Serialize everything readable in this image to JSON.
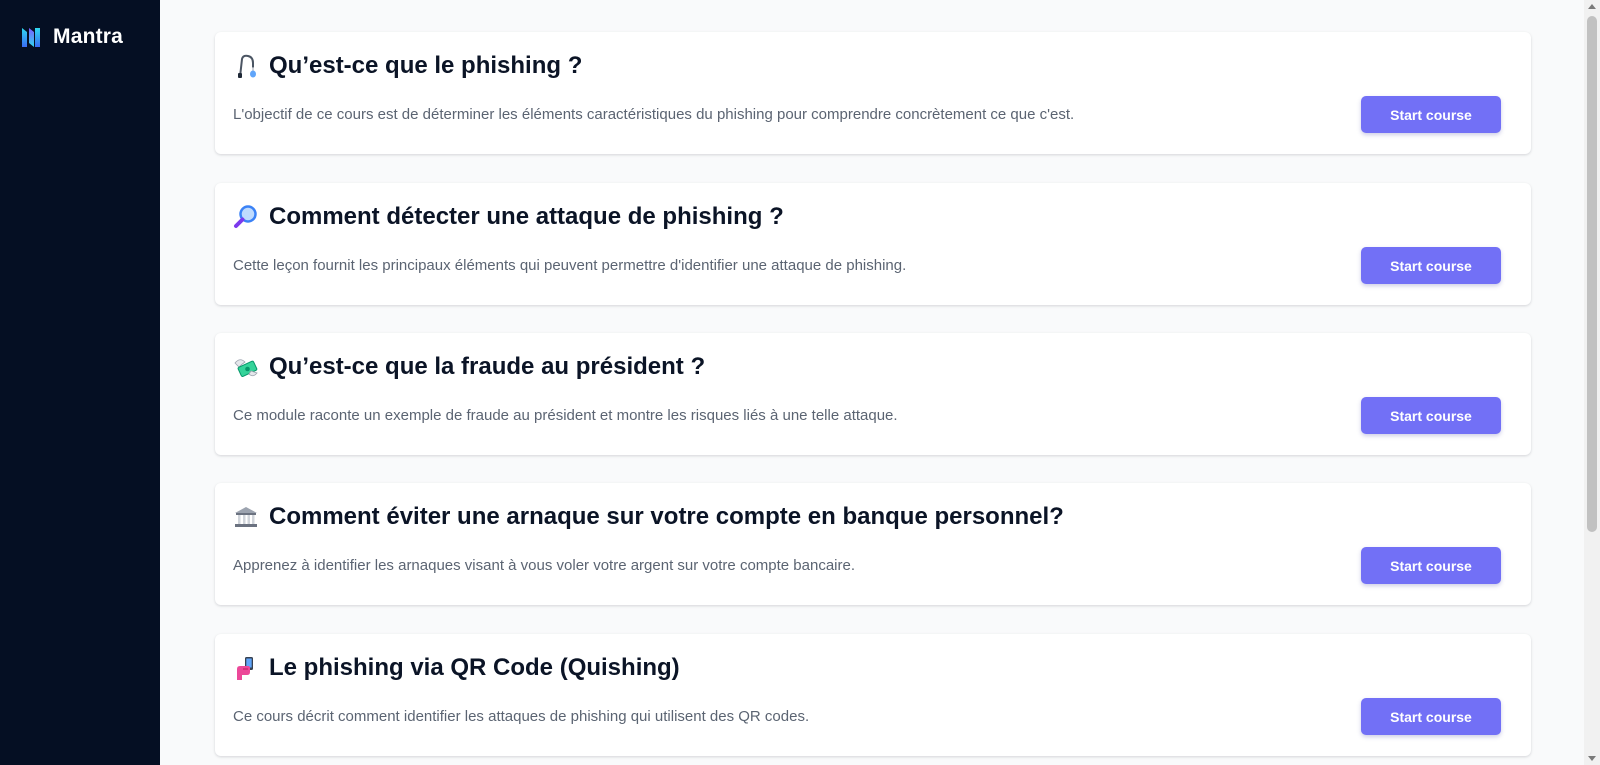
{
  "app": {
    "name": "Mantra"
  },
  "courses": [
    {
      "icon": "fishing-pole-icon",
      "title": "Qu’est-ce que le phishing ?",
      "description": "L'objectif de ce cours est de déterminer les éléments caractéristiques du phishing pour comprendre concrètement ce que c'est.",
      "button": "Start course"
    },
    {
      "icon": "magnifying-glass-icon",
      "title": "Comment détecter une attaque de phishing ?",
      "description": "Cette leçon fournit les principaux éléments qui peuvent permettre d'identifier une attaque de phishing.",
      "button": "Start course"
    },
    {
      "icon": "money-with-wings-icon",
      "title": "Qu’est-ce que la fraude au président ?",
      "description": "Ce module raconte un exemple de fraude au président et montre les risques liés à une telle attaque.",
      "button": "Start course"
    },
    {
      "icon": "bank-icon",
      "title": "Comment éviter une arnaque sur votre compte en banque personnel?",
      "description": "Apprenez à identifier les arnaques visant à vous voler votre argent sur votre compte bancaire.",
      "button": "Start course"
    },
    {
      "icon": "phone-in-hand-icon",
      "title": "Le phishing via QR Code (Quishing)",
      "description": "Ce cours décrit comment identifier les attaques de phishing qui utilisent des QR codes.",
      "button": "Start course"
    }
  ],
  "colors": {
    "sidebar_bg": "#050f23",
    "page_bg": "#f9fafb",
    "accent": "#7270f6",
    "title_text": "#0b1426",
    "body_text": "#5b6472"
  }
}
